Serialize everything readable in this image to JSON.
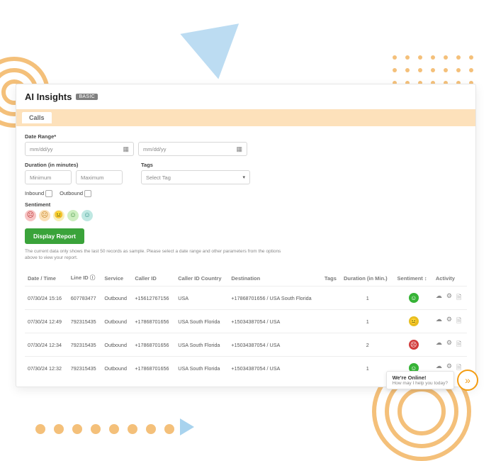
{
  "header": {
    "title": "AI Insights",
    "badge": "BASIC"
  },
  "tabs": {
    "active": "Calls"
  },
  "filters": {
    "dateRange": {
      "label": "Date Range*",
      "placeholder": "mm/dd/yy"
    },
    "duration": {
      "label": "Duration (in minutes)",
      "min_placeholder": "Minimum",
      "max_placeholder": "Maximum"
    },
    "tags": {
      "label": "Tags",
      "placeholder": "Select Tag"
    },
    "direction": {
      "inbound_label": "Inbound",
      "outbound_label": "Outbound"
    },
    "sentiment": {
      "label": "Sentiment"
    },
    "button": "Display Report",
    "note": "The current data only shows the last 50 records as sample. Please select a date range and other parameters from the options above to view your report."
  },
  "table": {
    "headers": {
      "datetime": "Date / Time",
      "lineid": "Line ID",
      "service": "Service",
      "callerid": "Caller ID",
      "country": "Caller ID Country",
      "destination": "Destination",
      "tags": "Tags",
      "duration": "Duration (in Min.)",
      "sentiment": "Sentiment",
      "activity": "Activity"
    },
    "rows": [
      {
        "datetime": "07/30/24 15:16",
        "lineid": "607783477",
        "service": "Outbound",
        "callerid": "+15612767156",
        "country": "USA",
        "destination": "+17868701656 / USA South Florida",
        "tags": "",
        "duration": "1",
        "sentiment": "positive"
      },
      {
        "datetime": "07/30/24 12:49",
        "lineid": "792315435",
        "service": "Outbound",
        "callerid": "+17868701656",
        "country": "USA South Florida",
        "destination": "+15034387054 / USA",
        "tags": "",
        "duration": "1",
        "sentiment": "neutral"
      },
      {
        "datetime": "07/30/24 12:34",
        "lineid": "792315435",
        "service": "Outbound",
        "callerid": "+17868701656",
        "country": "USA South Florida",
        "destination": "+15034387054 / USA",
        "tags": "",
        "duration": "2",
        "sentiment": "negative"
      },
      {
        "datetime": "07/30/24 12:32",
        "lineid": "792315435",
        "service": "Outbound",
        "callerid": "+17868701656",
        "country": "USA South Florida",
        "destination": "+15034387054 / USA",
        "tags": "",
        "duration": "1",
        "sentiment": "positive"
      }
    ]
  },
  "chat": {
    "title": "We're Online!",
    "subtitle": "How may I help you today?"
  },
  "icons": {
    "info": "ⓘ",
    "sort": "↕",
    "calendar": "▦",
    "caret": "▾",
    "cloud": "☁",
    "gear": "⚙",
    "doc": "🗎",
    "arrow": "»",
    "face_pos": "☺",
    "face_neu": "😐",
    "face_neg": "☹"
  }
}
